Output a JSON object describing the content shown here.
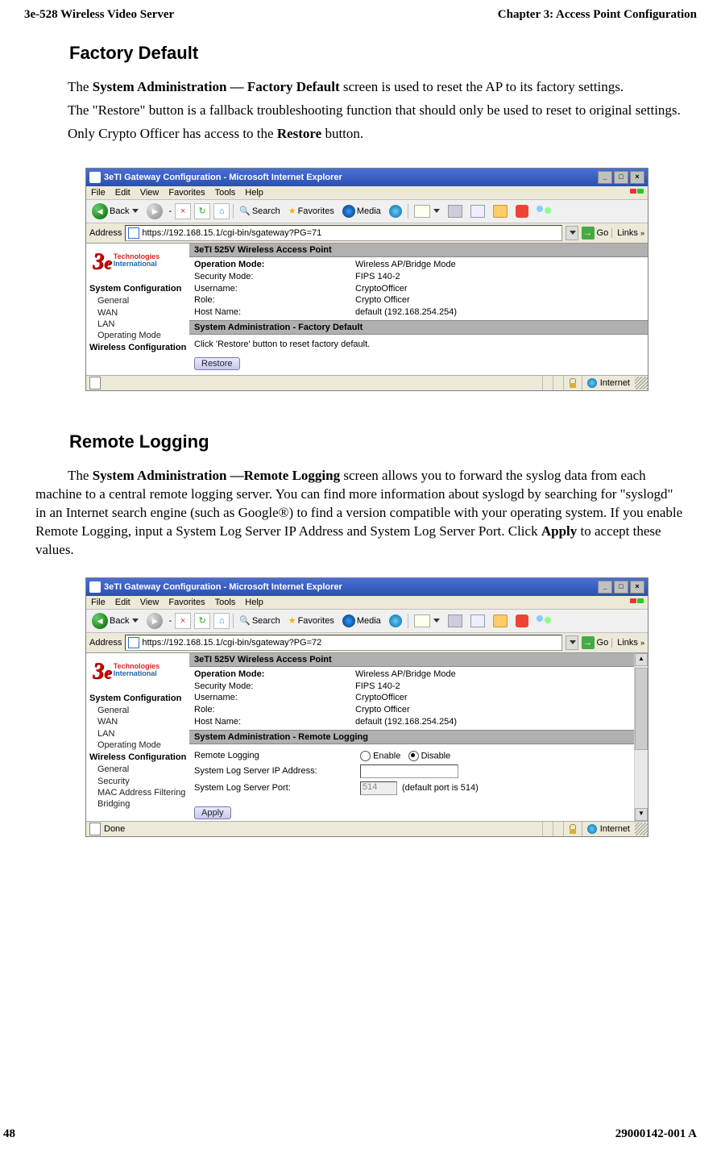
{
  "header": {
    "left": "3e-528 Wireless Video Server",
    "right": "Chapter 3: Access Point Configuration"
  },
  "s1": {
    "title": "Factory Default",
    "p1a": "The ",
    "p1b": "System Administration — Factory Default",
    "p1c": " screen is used to reset the AP to its factory settings.",
    "p2": "The \"Restore\" button is a fallback troubleshooting function that should only be used to reset to original settings.",
    "p3a": "Only Crypto Officer has access to the ",
    "p3b": "Restore",
    "p3c": " button."
  },
  "s2": {
    "title": "Remote Logging",
    "p1a": "The ",
    "p1b": "System Administration —Remote Logging",
    "p1c": " screen allows you to forward the syslog data from each machine to a central remote logging server. You can find more information about syslogd by searching for \"syslogd\" in an Internet search engine (such as Google®) to find a version compatible with your operating system. If you enable Remote Logging, input a System Log Server IP Address and System Log Server Port. Click ",
    "p1d": "Apply",
    "p1e": " to accept these values."
  },
  "ie": {
    "title": "3eTI Gateway Configuration - Microsoft Internet Explorer",
    "menu": {
      "file": "File",
      "edit": "Edit",
      "view": "View",
      "fav": "Favorites",
      "tools": "Tools",
      "help": "Help"
    },
    "toolbar": {
      "back": "Back",
      "search": "Search",
      "favorites": "Favorites",
      "media": "Media"
    },
    "address_label": "Address",
    "go": "Go",
    "links": "Links",
    "status_done": "Done",
    "status_internet": "Internet"
  },
  "shot1": {
    "url": "https://192.168.15.1/cgi-bin/sgateway?PG=71",
    "panel_title": "3eTI 525V Wireless Access Point",
    "info": {
      "r1l": "Operation Mode:",
      "r1v": "Wireless AP/Bridge Mode",
      "r2l": "Security Mode:",
      "r2v": "FIPS 140-2",
      "r3l": "Username:",
      "r3v": "CryptoOfficer",
      "r4l": "Role:",
      "r4v": "Crypto Officer",
      "r5l": "Host Name:",
      "r5v": "default (192.168.254.254)"
    },
    "section_title": "System Administration - Factory Default",
    "desc": "Click 'Restore' button to reset factory default.",
    "restore": "Restore",
    "side": {
      "h1": "System Configuration",
      "i1": "General",
      "i2": "WAN",
      "i3": "LAN",
      "i4": "Operating Mode",
      "h2": "Wireless Configuration"
    }
  },
  "shot2": {
    "url": "https://192.168.15.1/cgi-bin/sgateway?PG=72",
    "panel_title": "3eTI 525V Wireless Access Point",
    "info": {
      "r1l": "Operation Mode:",
      "r1v": "Wireless AP/Bridge Mode",
      "r2l": "Security Mode:",
      "r2v": "FIPS 140-2",
      "r3l": "Username:",
      "r3v": "CryptoOfficer",
      "r4l": "Role:",
      "r4v": "Crypto Officer",
      "r5l": "Host Name:",
      "r5v": "default (192.168.254.254)"
    },
    "section_title": "System Administration - Remote Logging",
    "form": {
      "f1l": "Remote Logging",
      "f1a": "Enable",
      "f1b": "Disable",
      "f2l": "System Log Server IP Address:",
      "f3l": "System Log Server Port:",
      "f3v": "514",
      "f3n": "(default port is 514)"
    },
    "apply": "Apply",
    "side": {
      "h1": "System Configuration",
      "i1": "General",
      "i2": "WAN",
      "i3": "LAN",
      "i4": "Operating Mode",
      "h2": "Wireless Configuration",
      "j1": "General",
      "j2": "Security",
      "j3": "MAC Address Filtering",
      "j4": "Bridging"
    }
  },
  "footer": {
    "left": "48",
    "right": "29000142-001 A"
  }
}
